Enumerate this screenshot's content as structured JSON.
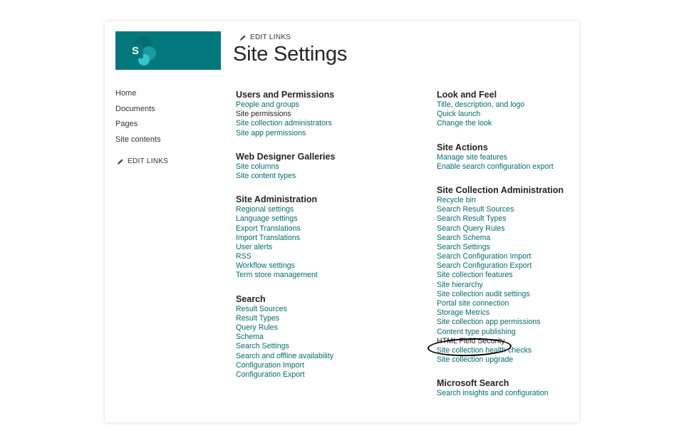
{
  "header": {
    "edit_links": "EDIT LINKS",
    "title": "Site Settings",
    "logo_letter": "S",
    "brand_color": "#03787c"
  },
  "nav": {
    "items": [
      "Home",
      "Documents",
      "Pages",
      "Site contents"
    ],
    "edit_links": "EDIT LINKS"
  },
  "left_column": [
    {
      "title": "Users and Permissions",
      "links": [
        "People and groups",
        "Site permissions",
        "Site collection administrators",
        "Site app permissions"
      ]
    },
    {
      "title": "Web Designer Galleries",
      "links": [
        "Site columns",
        "Site content types"
      ]
    },
    {
      "title": "Site Administration",
      "links": [
        "Regional settings",
        "Language settings",
        "Export Translations",
        "Import Translations",
        "User alerts",
        "RSS",
        "Workflow settings",
        "Term store management"
      ]
    },
    {
      "title": "Search",
      "links": [
        "Result Sources",
        "Result Types",
        "Query Rules",
        "Schema",
        "Search Settings",
        "Search and offline availability",
        "Configuration Import",
        "Configuration Export"
      ]
    }
  ],
  "right_column": [
    {
      "title": "Look and Feel",
      "links": [
        "Title, description, and logo",
        "Quick launch",
        "Change the look"
      ]
    },
    {
      "title": "Site Actions",
      "links": [
        "Manage site features",
        "Enable search configuration export"
      ]
    },
    {
      "title": "Site Collection Administration",
      "links": [
        "Recycle bin",
        "Search Result Sources",
        "Search Result Types",
        "Search Query Rules",
        "Search Schema",
        "Search Settings",
        "Search Configuration Import",
        "Search Configuration Export",
        "Site collection features",
        "Site hierarchy",
        "Site collection audit settings",
        "Portal site connection",
        "Storage Metrics",
        "Site collection app permissions",
        "Content type publishing",
        "HTML Field Security",
        "Site collection health checks",
        "Site collection upgrade"
      ]
    },
    {
      "title": "Microsoft Search",
      "links": [
        "Search insights and configuration"
      ]
    }
  ],
  "colors": {
    "link": "#036c70",
    "text": "#252525"
  }
}
